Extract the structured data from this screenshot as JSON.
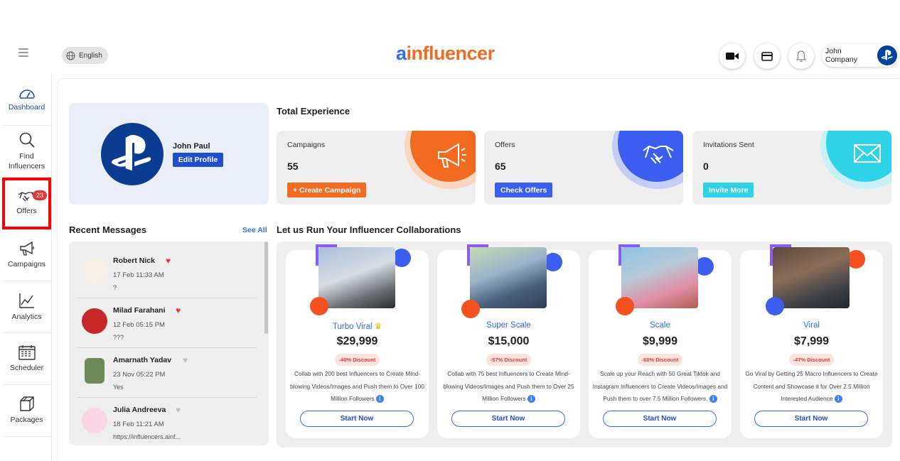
{
  "header": {
    "language": "English",
    "logo_a": "a",
    "logo_i": "i",
    "logo_rest": "nfluencer",
    "user_name": "John Company"
  },
  "sidebar": {
    "items": [
      {
        "label": "Dashboard",
        "icon": "dashboard-gauge-icon"
      },
      {
        "label": "Find Influencers",
        "icon": "search-icon"
      },
      {
        "label": "Offers",
        "icon": "handshake-icon",
        "badge": "23"
      },
      {
        "label": "Campaigns",
        "icon": "megaphone-icon"
      },
      {
        "label": "Analytics",
        "icon": "analytics-chart-icon"
      },
      {
        "label": "Scheduler",
        "icon": "calendar-icon"
      },
      {
        "label": "Packages",
        "icon": "package-box-icon"
      }
    ]
  },
  "profile": {
    "name": "John Paul",
    "edit_label": "Edit Profile"
  },
  "total_experience": {
    "title": "Total Experience",
    "stats": [
      {
        "label": "Campaigns",
        "value": "55",
        "button": "+ Create Campaign",
        "color": "#f26b21"
      },
      {
        "label": "Offers",
        "value": "65",
        "button": "Check Offers",
        "color": "#3b5ef0"
      },
      {
        "label": "Invitations Sent",
        "value": "0",
        "button": "Invite More",
        "color": "#2fd3e8"
      }
    ]
  },
  "messages": {
    "title": "Recent Messages",
    "see_all": "See All",
    "items": [
      {
        "name": "Robert Nick",
        "date": "17 Feb 11:33 AM",
        "text": "?",
        "favorite": true
      },
      {
        "name": "Milad Farahani",
        "date": "12 Feb 05:15 PM",
        "text": "???",
        "favorite": true
      },
      {
        "name": "Amarnath Yadav",
        "date": "23 Nov 05:22 PM",
        "text": "Yes",
        "favorite": false
      },
      {
        "name": "Julia Andreeva",
        "date": "18 Feb 11:21 AM",
        "text": "https://influencers.ainf...",
        "favorite": false
      }
    ]
  },
  "packages": {
    "title": "Let us Run Your Influencer Collaborations",
    "items": [
      {
        "name": "Turbo Viral",
        "price": "$29,999",
        "discount": "-40% Discount",
        "description": "Collab with 200 best Influencers to Create Mind-blowing Videos/Images and Push them to Over 100 Million Followers",
        "button": "Start Now"
      },
      {
        "name": "Super Scale",
        "price": "$15,000",
        "discount": "-57% Discount",
        "description": "Collab with 75 best Influencers to Create Mind-blowing Videos/Images and Push them to Over 25 Million Followers",
        "button": "Start Now"
      },
      {
        "name": "Scale",
        "price": "$9,999",
        "discount": "-60% Discount",
        "description": "Scale up your Reach with 50 Great Tiktok and Instagram Influencers to Create Videos/Images and Push them to over 7.5 Million Followers.",
        "button": "Start Now"
      },
      {
        "name": "Viral",
        "price": "$7,999",
        "discount": "-47% Discount",
        "description": "Go Viral by Getting 25 Macro Influencers to Create Content and Showcase it for Over 2.5 Million Interested Audience",
        "button": "Start Now"
      }
    ]
  }
}
